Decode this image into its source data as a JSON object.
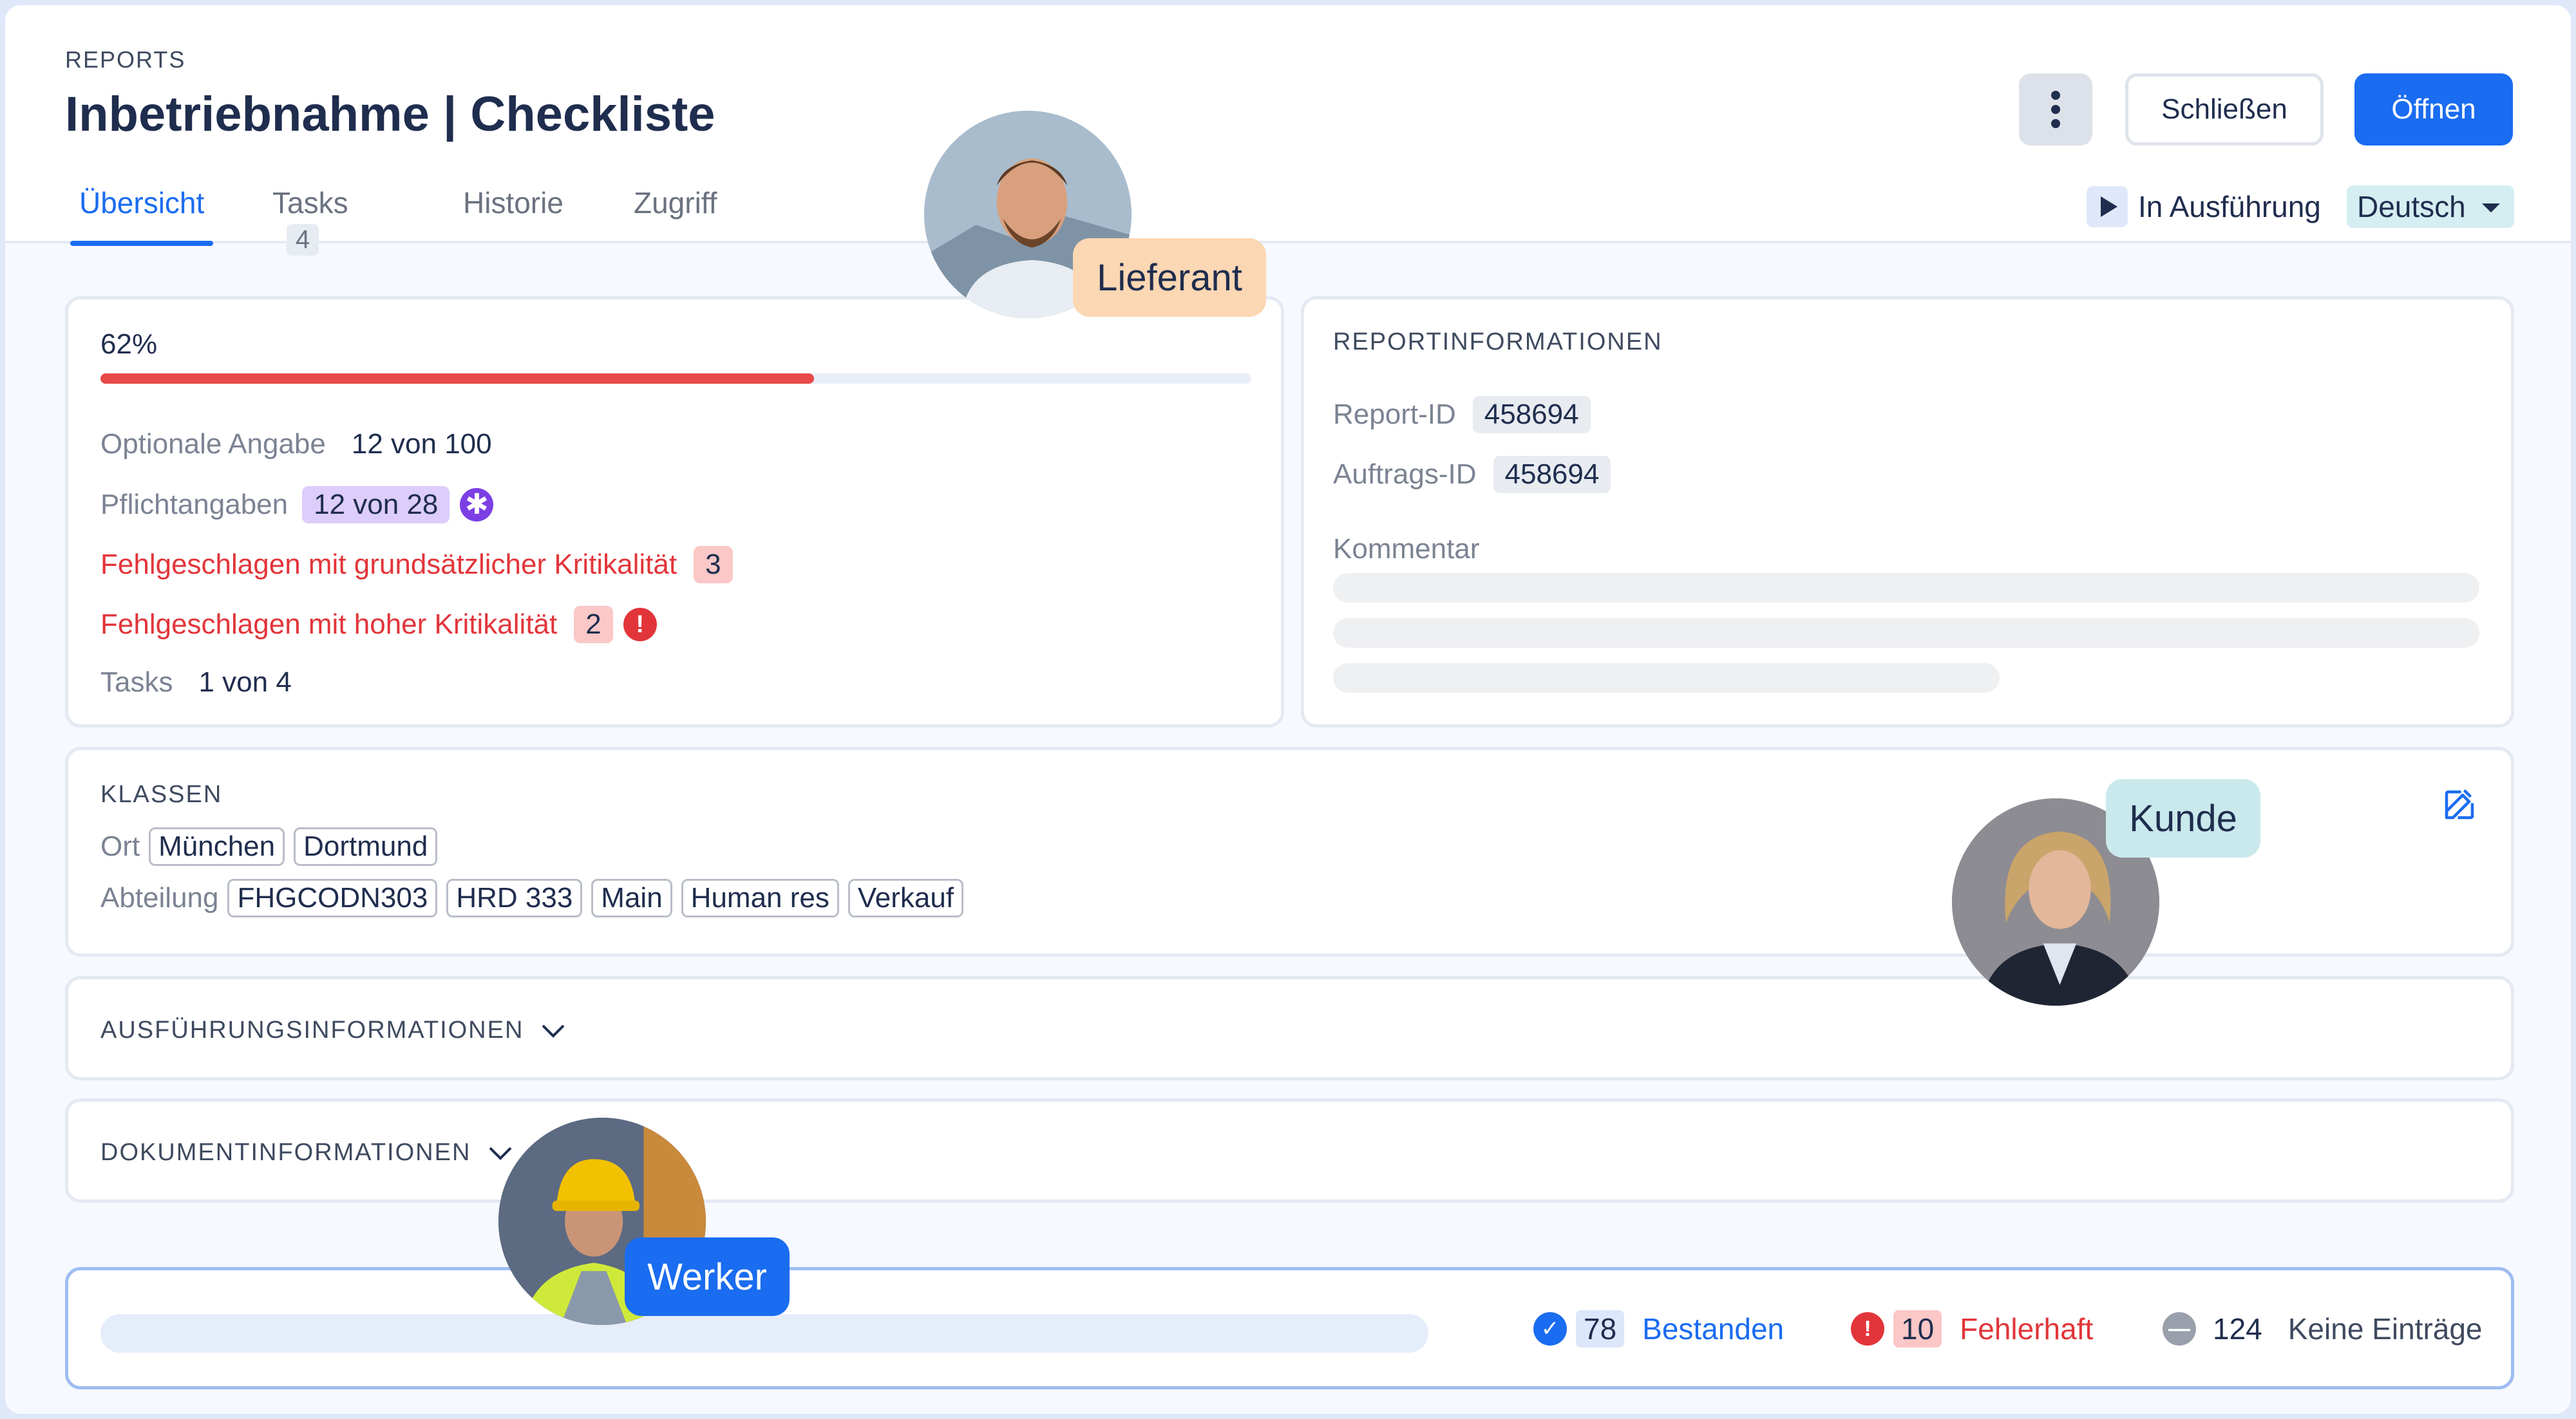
{
  "header": {
    "eyebrow": "REPORTS",
    "title": "Inbetriebnahme | Checkliste",
    "close_label": "Schließen",
    "open_label": "Öffnen",
    "menu_icon": "more-vertical-icon"
  },
  "tabs": [
    {
      "label": "Übersicht",
      "active": true
    },
    {
      "label": "Tasks",
      "count": "4"
    },
    {
      "label": "Historie"
    },
    {
      "label": "Zugriff"
    }
  ],
  "status": {
    "label": "In Ausführung",
    "icon": "play-icon"
  },
  "language": {
    "selected": "Deutsch"
  },
  "progress": {
    "percent_label": "62%",
    "percent": 62,
    "optional_label": "Optionale Angabe",
    "optional_value": "12 von 100",
    "required_label": "Pflichtangaben",
    "required_value": "12 von 28",
    "failed_basic_label": "Fehlgeschlagen mit grundsätzlicher Kritikalität",
    "failed_basic_count": "3",
    "failed_high_label": "Fehlgeschlagen mit hoher Kritikalität",
    "failed_high_count": "2",
    "tasks_label": "Tasks",
    "tasks_value": "1 von 4",
    "bar_color": "#e8484a"
  },
  "report_info": {
    "title": "REPORTINFORMATIONEN",
    "report_id_label": "Report-ID",
    "report_id": "458694",
    "order_id_label": "Auftrags-ID",
    "order_id": "458694",
    "comment_label": "Kommentar"
  },
  "classes": {
    "title": "KLASSEN",
    "location_label": "Ort",
    "locations": [
      "München",
      "Dortmund"
    ],
    "department_label": "Abteilung",
    "departments": [
      "FHGCODN303",
      "HRD 333",
      "Main",
      "Human res",
      "Verkauf"
    ]
  },
  "sections": {
    "execution": "AUSFÜHRUNGSINFORMATIONEN",
    "document": "DOKUMENTINFORMATIONEN"
  },
  "footer": {
    "passed_count": "78",
    "passed_label": "Bestanden",
    "failed_count": "10",
    "failed_label": "Fehlerhaft",
    "empty_count": "124",
    "empty_label": "Keine Einträge"
  },
  "personas": {
    "supplier": "Lieferant",
    "customer": "Kunde",
    "worker": "Werker"
  },
  "colors": {
    "primary": "#1a6cf0",
    "danger": "#e2353a",
    "required": "#7b3fe4",
    "supplier_badge": "#fbd7b3",
    "customer_badge": "#c9e9ec",
    "worker_badge": "#1a6cf0"
  }
}
